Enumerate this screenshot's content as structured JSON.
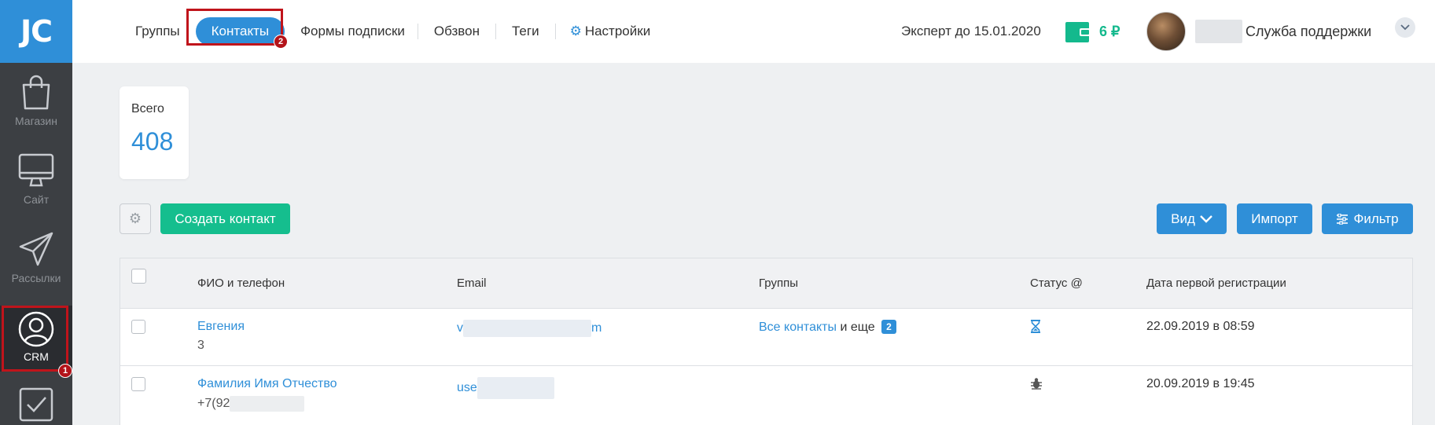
{
  "sidebar": {
    "logo": "JC",
    "items": [
      {
        "label": "Магазин",
        "icon": "bag-icon"
      },
      {
        "label": "Сайт",
        "icon": "monitor-icon"
      },
      {
        "label": "Рассылки",
        "icon": "paper-plane-icon"
      },
      {
        "label": "CRM",
        "icon": "user-circle-icon"
      },
      {
        "label": "",
        "icon": "checkbox-icon"
      }
    ],
    "crm_marker": "1"
  },
  "nav": {
    "items": [
      "Группы",
      "Контакты",
      "Формы подписки",
      "Обзвон",
      "Теги",
      "Настройки"
    ],
    "active": "Контакты",
    "active_marker": "2"
  },
  "header": {
    "plan": "Эксперт до 15.01.2020",
    "balance": "6 ₽",
    "user_name": "Служба поддержки"
  },
  "stats": {
    "label": "Всего",
    "value": "408"
  },
  "toolbar": {
    "create_label": "Создать контакт",
    "view_label": "Вид",
    "import_label": "Импорт",
    "filter_label": "Фильтр"
  },
  "table": {
    "headers": {
      "name": "ФИО и телефон",
      "email": "Email",
      "groups": "Группы",
      "status": "Статус @",
      "date": "Дата первой регистрации"
    },
    "rows": [
      {
        "name": "Евгения",
        "phone": "3",
        "email_start": "v",
        "email_end": "m",
        "groups_link": "Все контакты",
        "groups_more": "и еще",
        "groups_count": "2",
        "status_icon": "hourglass-icon",
        "date": "22.09.2019 в 08:59"
      },
      {
        "name": "Фамилия Имя Отчество",
        "phone": "+7(92",
        "email_start": "use",
        "email_end": "",
        "groups_link": "",
        "groups_more": "",
        "groups_count": "",
        "status_icon": "bug-icon",
        "date": "20.09.2019 в 19:45"
      }
    ]
  },
  "colors": {
    "accent": "#2f8fd8",
    "green": "#15be8e",
    "sidebar": "#3c3f43",
    "highlight": "#c0141b"
  }
}
